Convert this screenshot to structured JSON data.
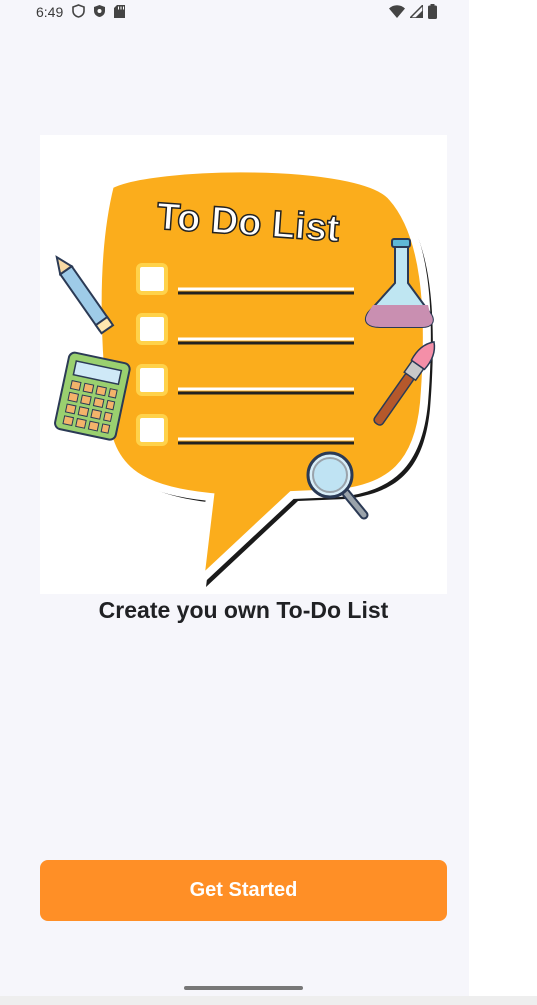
{
  "status_bar": {
    "time": "6:49",
    "left_icons": [
      "shield-icon",
      "shield-check-icon",
      "sd-card-icon"
    ],
    "right_icons": [
      "wifi-icon",
      "signal-icon",
      "battery-icon"
    ]
  },
  "hero": {
    "illustration_title": "To Do List",
    "checklist_rows": 4,
    "decor_icons": [
      "pencil-icon",
      "calculator-icon",
      "flask-icon",
      "paintbrush-icon",
      "magnifier-icon"
    ]
  },
  "headline": "Create you own To-Do List",
  "cta": {
    "label": "Get Started",
    "color": "#ff8f26"
  },
  "colors": {
    "bubble": "#fbad1c",
    "background": "#f6f6fb"
  }
}
